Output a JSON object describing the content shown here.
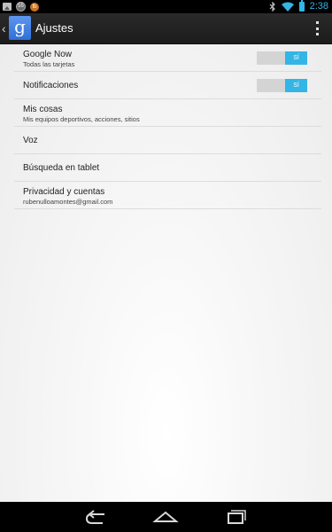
{
  "status_bar": {
    "badge_1": "55",
    "badge_2": "fb",
    "time": "2:38",
    "icons": [
      "image-icon",
      "notification-badge-icon",
      "app-badge-icon",
      "bluetooth-icon",
      "wifi-icon",
      "battery-icon"
    ]
  },
  "action_bar": {
    "app_icon_glyph": "g",
    "title": "Ajustes",
    "icons": [
      "up-caret-icon",
      "google-app-icon",
      "overflow-menu-icon"
    ]
  },
  "settings": {
    "items": [
      {
        "title": "Google Now",
        "summary": "Todas las tarjetas",
        "switch": "SÍ"
      },
      {
        "title": "Notificaciones",
        "switch": "SÍ"
      },
      {
        "title": "Mis cosas",
        "summary": "Mis equipos deportivos, acciones, sitios"
      },
      {
        "title": "Voz"
      },
      {
        "title": "Búsqueda en tablet"
      },
      {
        "title": "Privacidad y cuentas",
        "summary": "rubenulloamontes@gmail.com"
      }
    ]
  },
  "nav_bar": {
    "icons": [
      "back-icon",
      "home-icon",
      "recent-apps-icon"
    ]
  },
  "colors": {
    "accent": "#33b5e5",
    "action_bar": "#222222",
    "background": "#f2f2f2"
  }
}
